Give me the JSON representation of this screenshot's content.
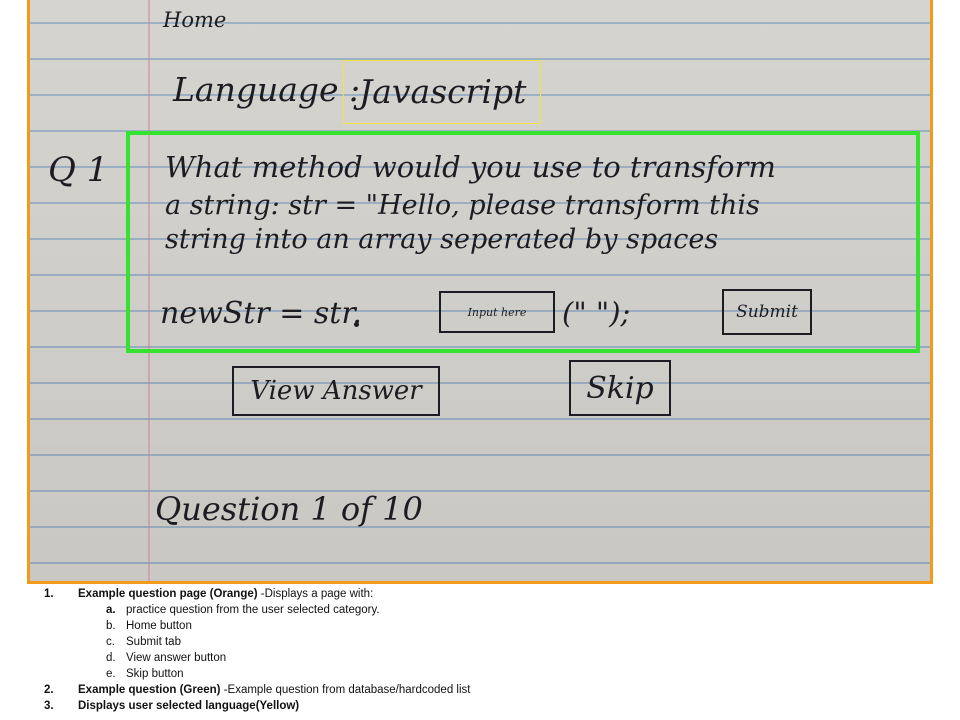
{
  "photo": {
    "home_link": "Home",
    "language_label": "Language :",
    "language_value": "Javascript",
    "question_number": "Q 1",
    "question_line1": "What method would you use to transform",
    "question_line2": "a string:  str = \"Hello, please transform this",
    "question_line3": "string into an array seperated by spaces",
    "code_prefix": "newStr = str.",
    "input_placeholder": "Input here",
    "code_suffix": "(\" \");",
    "submit_label": "Submit",
    "view_answer_label": "View Answer",
    "skip_label": "Skip",
    "progress_text": "Question 1 of 10",
    "colors": {
      "orange": "#f29a1b",
      "green": "#35e22f",
      "yellow": "#f1e24a"
    }
  },
  "legend": {
    "item1_num": "1.",
    "item1_title": "Example question page (Orange)",
    "item1_desc": " -Displays a page with:",
    "subitems": [
      {
        "letter": "a.",
        "text": "practice question from the user selected category."
      },
      {
        "letter": "b.",
        "text": "Home button"
      },
      {
        "letter": "c.",
        "text": "Submit tab"
      },
      {
        "letter": "d.",
        "text": "View answer button"
      },
      {
        "letter": "e.",
        "text": "Skip button"
      }
    ],
    "item2_num": "2.",
    "item2_title": "Example question (Green)",
    "item2_desc": " -Example question from database/hardcoded list",
    "item3_num": "3.",
    "item3_title": "Displays user selected language(Yellow)"
  }
}
